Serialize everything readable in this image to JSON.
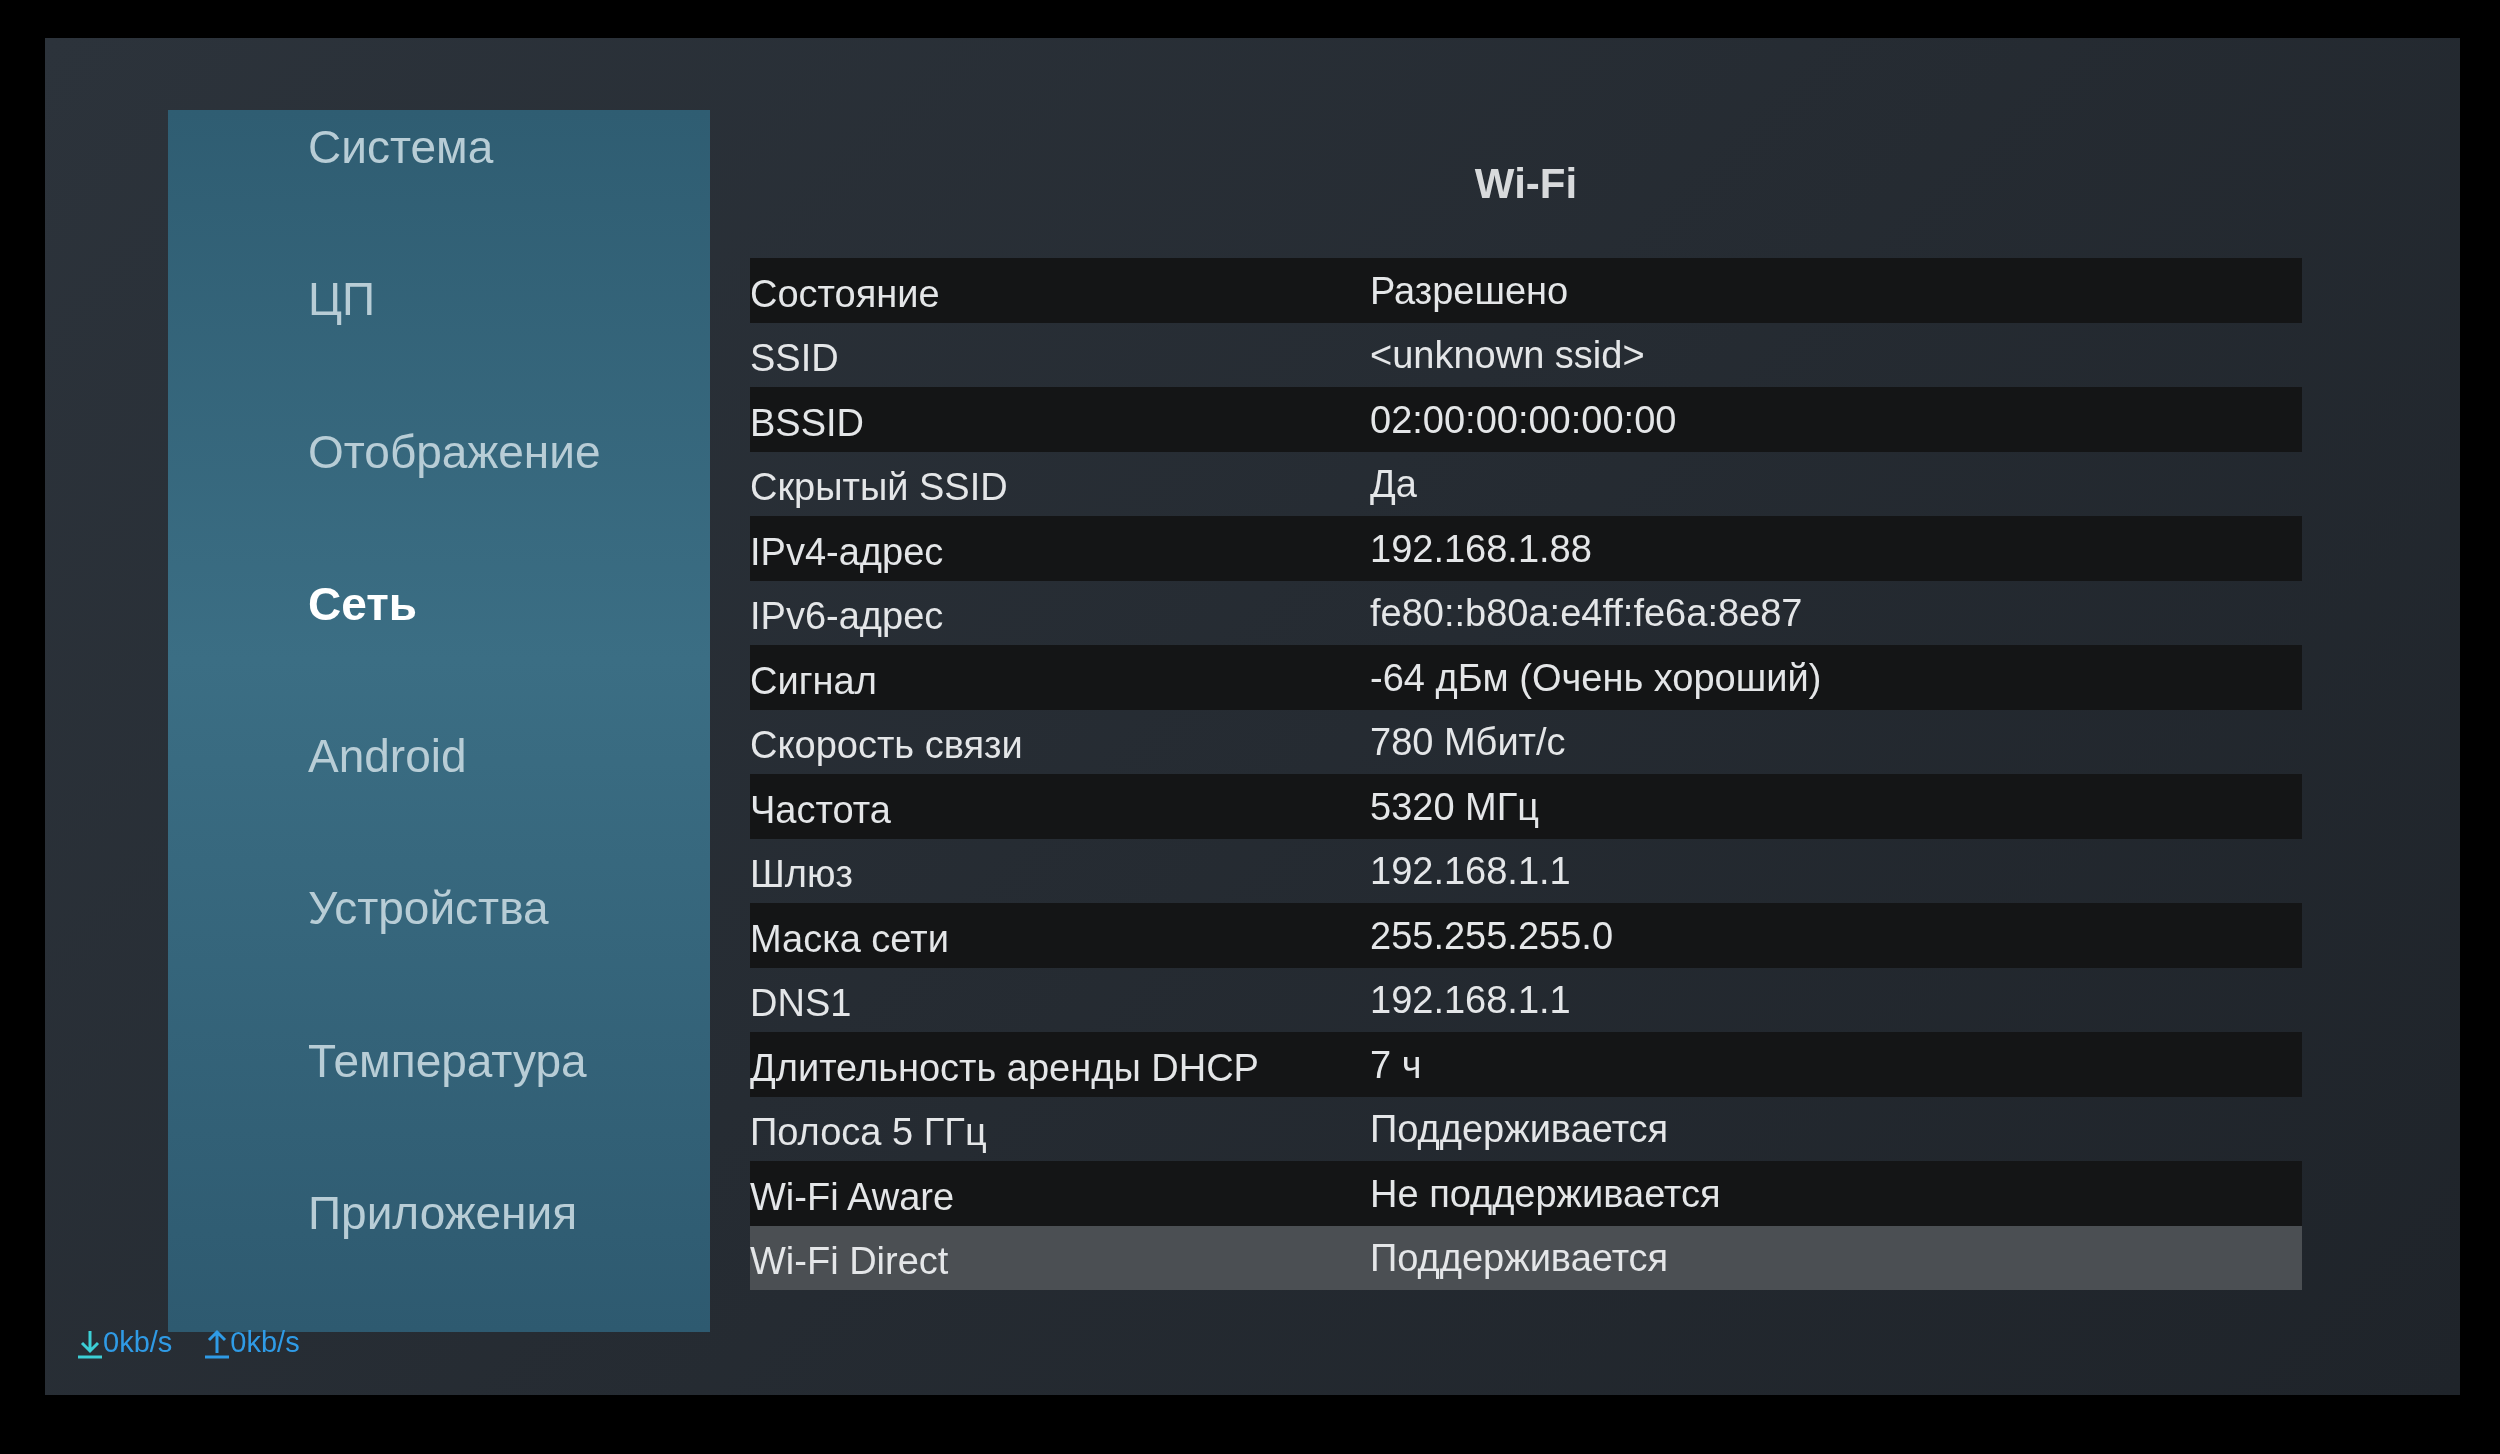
{
  "sidebar": {
    "items": [
      {
        "label": "Система",
        "selected": false
      },
      {
        "label": "ЦП",
        "selected": false
      },
      {
        "label": "Отображение",
        "selected": false
      },
      {
        "label": "Сеть",
        "selected": true
      },
      {
        "label": "Android",
        "selected": false
      },
      {
        "label": "Устройства",
        "selected": false
      },
      {
        "label": "Температура",
        "selected": false
      },
      {
        "label": "Приложения",
        "selected": false
      }
    ]
  },
  "panel": {
    "title": "Wi-Fi",
    "rows": [
      {
        "label": "Состояние",
        "value": "Разрешено",
        "selected": false
      },
      {
        "label": "SSID",
        "value": "<unknown ssid>",
        "selected": false
      },
      {
        "label": "BSSID",
        "value": "02:00:00:00:00:00",
        "selected": false
      },
      {
        "label": "Скрытый SSID",
        "value": "Да",
        "selected": false
      },
      {
        "label": "IPv4-адрес",
        "value": "192.168.1.88",
        "selected": false
      },
      {
        "label": "IPv6-адрес",
        "value": "fe80::b80a:e4ff:fe6a:8e87",
        "selected": false
      },
      {
        "label": "Сигнал",
        "value": "-64 дБм (Очень хороший)",
        "selected": false
      },
      {
        "label": "Скорость связи",
        "value": "780 Мбит/с",
        "selected": false
      },
      {
        "label": "Частота",
        "value": "5320 МГц",
        "selected": false
      },
      {
        "label": "Шлюз",
        "value": "192.168.1.1",
        "selected": false
      },
      {
        "label": "Маска сети",
        "value": "255.255.255.0",
        "selected": false
      },
      {
        "label": "DNS1",
        "value": "192.168.1.1",
        "selected": false
      },
      {
        "label": "Длительность аренды DHCP",
        "value": "7 ч",
        "selected": false
      },
      {
        "label": "Полоса 5 ГГц",
        "value": "Поддерживается",
        "selected": false
      },
      {
        "label": "Wi-Fi Aware",
        "value": "Не поддерживается",
        "selected": false
      },
      {
        "label": "Wi-Fi Direct",
        "value": "Поддерживается",
        "selected": true
      }
    ]
  },
  "status_bar": {
    "download": "0kb/s",
    "upload": "0kb/s"
  }
}
